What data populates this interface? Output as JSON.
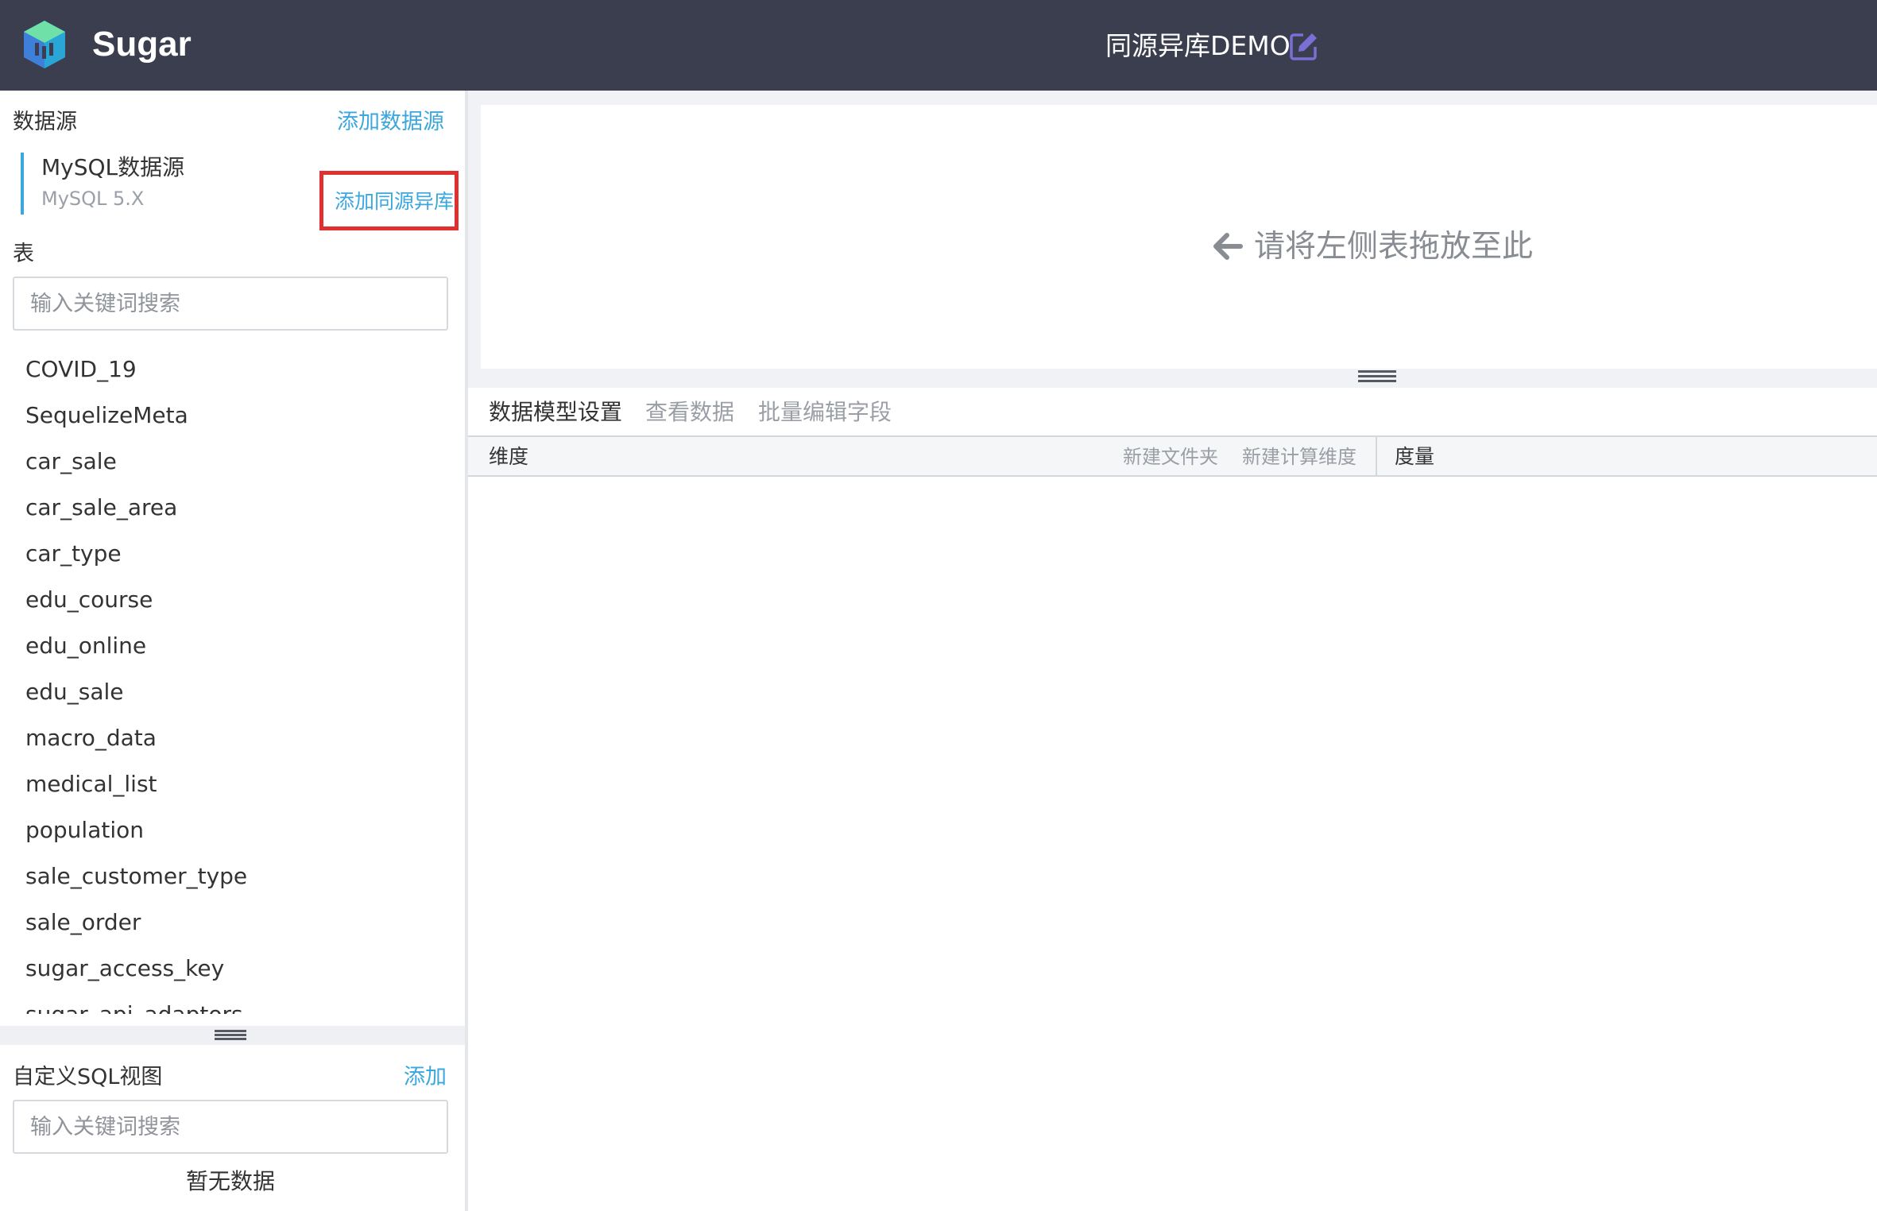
{
  "header": {
    "brand": "Sugar",
    "title": "同源异库DEMO",
    "logo_icon": "sugar-cube-logo",
    "edit_icon": "edit-icon",
    "background": "#3a3e4e",
    "accent": "#7b6fd6"
  },
  "datasource": {
    "label": "数据源",
    "add_link": "添加数据源",
    "item": {
      "name": "MySQL数据源",
      "version": "MySQL 5.X"
    },
    "add_same_source": "添加同源异库"
  },
  "tables": {
    "label": "表",
    "search_placeholder": "输入关键词搜索",
    "items": [
      "COVID_19",
      "SequelizeMeta",
      "car_sale",
      "car_sale_area",
      "car_type",
      "edu_course",
      "edu_online",
      "edu_sale",
      "macro_data",
      "medical_list",
      "population",
      "sale_customer_type",
      "sale_order",
      "sugar_access_key",
      "sugar_api_adaptors"
    ]
  },
  "custom_sql": {
    "label": "自定义SQL视图",
    "add_link": "添加",
    "search_placeholder": "输入关键词搜索",
    "empty_text": "暂无数据"
  },
  "drop_zone": {
    "hint": "请将左侧表拖放至此",
    "arrow_icon": "arrow-left-icon"
  },
  "tabs": [
    {
      "label": "数据模型设置",
      "active": true
    },
    {
      "label": "查看数据",
      "active": false
    },
    {
      "label": "批量编辑字段",
      "active": false
    }
  ],
  "fields": {
    "dimension_label": "维度",
    "new_folder": "新建文件夹",
    "new_calc_dimension": "新建计算维度",
    "measure_label": "度量"
  },
  "colors": {
    "link": "#3ba7dd",
    "highlight_border": "#e03030"
  }
}
